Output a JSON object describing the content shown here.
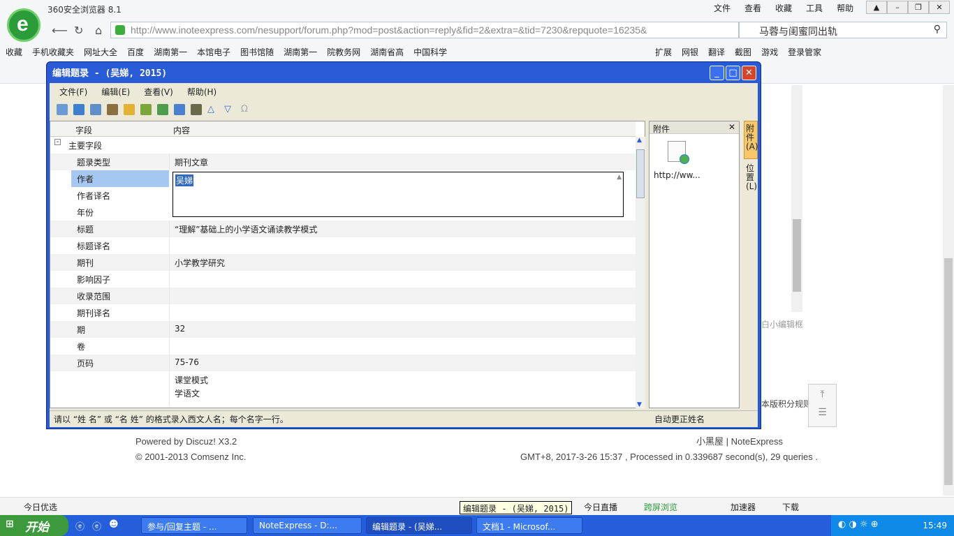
{
  "browser": {
    "title": "360安全浏览器 8.1",
    "menu": [
      "文件",
      "查看",
      "收藏",
      "工具",
      "帮助"
    ],
    "url": "http://www.inoteexpress.com/nesupport/forum.php?mod=post&action=reply&fid=2&extra=&tid=7230&repquote=16235&",
    "search": "马蓉与闺蜜同出轨",
    "bookmarks": [
      "收藏",
      "手机收藏夹",
      "网址大全",
      "百度",
      "湖南第一",
      "本馆电子",
      "图书馆随",
      "湖南第一",
      "院教务网",
      "湖南省高",
      "中国科学"
    ],
    "toolbar_right": [
      "扩展",
      "网银",
      "翻译",
      "截图",
      "游戏",
      "登录管家"
    ]
  },
  "page": {
    "footer_powered": "Powered by Discuz! X3.2",
    "footer_copy": "© 2001-2013 Comsenz Inc.",
    "footer_links": "小黑屋 | NoteExpress",
    "footer_time": "GMT+8, 2017-3-26 15:37 , Processed in 0.339687 second(s), 29 queries .",
    "side_text": "本版积分规则",
    "editor_hint": "白小编辑框",
    "bottom_left": "今日优选",
    "bottom_right": [
      "今日直播",
      "跨屏浏览",
      "加速器",
      "下载"
    ]
  },
  "dialog": {
    "title": "编辑题录 - (吴娣, 2015)",
    "menu": [
      "文件(F)",
      "编辑(E)",
      "查看(V)",
      "帮助(H)"
    ],
    "col_field": "字段",
    "col_content": "内容",
    "group": "主要字段",
    "fields": [
      {
        "name": "题录类型",
        "value": "期刊文章"
      },
      {
        "name": "作者",
        "value": "吴娣"
      },
      {
        "name": "作者译名",
        "value": ""
      },
      {
        "name": "年份",
        "value": ""
      },
      {
        "name": "标题",
        "value": "“理解”基础上的小学语文诵读教学模式"
      },
      {
        "name": "标题译名",
        "value": ""
      },
      {
        "name": "期刊",
        "value": "小学教学研究"
      },
      {
        "name": "影响因子",
        "value": ""
      },
      {
        "name": "收录范围",
        "value": ""
      },
      {
        "name": "期刊译名",
        "value": ""
      },
      {
        "name": "期",
        "value": "32"
      },
      {
        "name": "卷",
        "value": ""
      },
      {
        "name": "页码",
        "value": "75-76"
      },
      {
        "name": "",
        "value": "课堂模式\n学语文"
      }
    ],
    "attachment_title": "附件",
    "attachment_text": "http://ww...",
    "side_tab1": "附件(A)",
    "side_tab2": "位置(L)",
    "status_left": "请以 “姓 名” 或 “名 姓” 的格式录入西文人名；每个名字一行。",
    "status_right": "自动更正姓名"
  },
  "taskbar": {
    "start": "开始",
    "tasks": [
      "参与/回复主题 - ...",
      "NoteExpress - D:...",
      "编辑题录 - (吴娣...",
      "文档1 - Microsof..."
    ],
    "tooltip": "编辑题录 - (吴娣, 2015)",
    "clock": "15:49"
  }
}
